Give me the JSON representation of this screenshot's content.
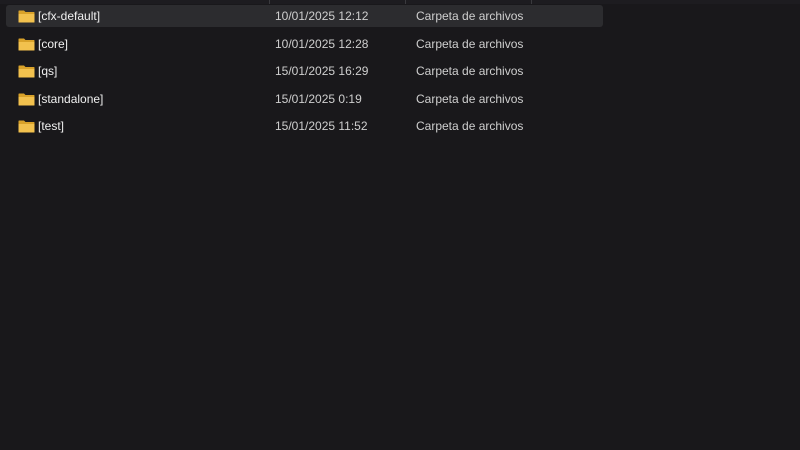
{
  "colors": {
    "background": "#19181b",
    "selected_row": "#2c2c2f",
    "folder": "#f2c14e",
    "folder_dark": "#d9a22a",
    "text": "#f0f0f0",
    "muted_text": "#cfcfcf"
  },
  "files": [
    {
      "name": "[cfx-default]",
      "modified": "10/01/2025 12:12",
      "type": "Carpeta de archivos",
      "icon": "folder-icon",
      "selected": true
    },
    {
      "name": "[core]",
      "modified": "10/01/2025 12:28",
      "type": "Carpeta de archivos",
      "icon": "folder-icon",
      "selected": false
    },
    {
      "name": "[qs]",
      "modified": "15/01/2025 16:29",
      "type": "Carpeta de archivos",
      "icon": "folder-icon",
      "selected": false
    },
    {
      "name": "[standalone]",
      "modified": "15/01/2025 0:19",
      "type": "Carpeta de archivos",
      "icon": "folder-icon",
      "selected": false
    },
    {
      "name": "[test]",
      "modified": "15/01/2025 11:52",
      "type": "Carpeta de archivos",
      "icon": "folder-icon",
      "selected": false
    }
  ]
}
